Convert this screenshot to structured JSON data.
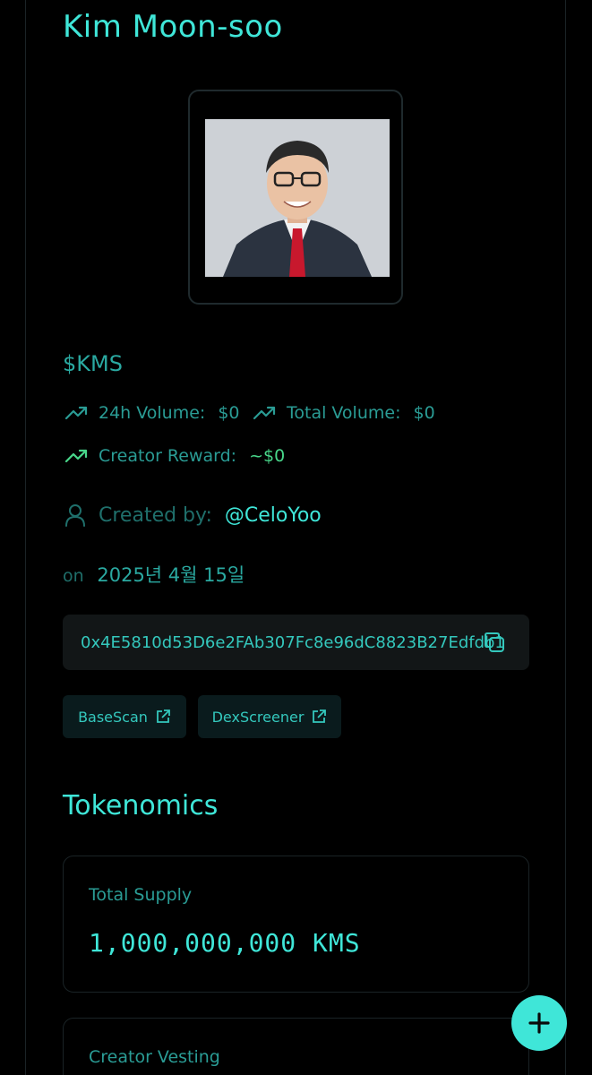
{
  "token": {
    "name": "Kim Moon-soo",
    "symbol": "$KMS"
  },
  "stats": {
    "volume_24h_label": "24h Volume:",
    "volume_24h_value": "$0",
    "total_volume_label": "Total Volume:",
    "total_volume_value": "$0",
    "creator_reward_label": "Creator Reward:",
    "creator_reward_value": "~$0"
  },
  "creator": {
    "label": "Created by:",
    "handle": "@CeloYoo",
    "on_label": "on",
    "date": "2025년 4월 15일"
  },
  "contract": {
    "address": "0x4E5810d53D6e2FAb307Fc8e96dC8823B27Edfdb1"
  },
  "links": {
    "basescan": "BaseScan",
    "dexscreener": "DexScreener"
  },
  "tokenomics": {
    "title": "Tokenomics",
    "total_supply_label": "Total Supply",
    "total_supply_value": "1,000,000,000 KMS",
    "creator_vesting_label": "Creator Vesting"
  },
  "colors": {
    "accent": "#3fe6d8",
    "muted": "#2a9c95",
    "green": "#48d68a",
    "background": "#000000"
  },
  "icons": {
    "trend": "trending-up-icon",
    "user": "user-icon",
    "copy": "copy-icon",
    "external": "external-link-icon",
    "add": "plus-icon"
  }
}
